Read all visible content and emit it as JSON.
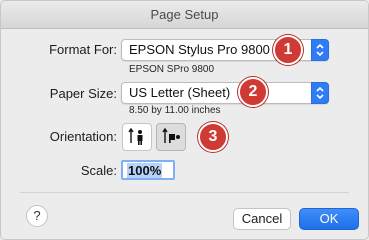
{
  "window": {
    "title": "Page Setup"
  },
  "format_for": {
    "label": "Format For:",
    "value": "EPSON Stylus Pro 9800",
    "subtitle": "EPSON SPro 9800",
    "badge": "1"
  },
  "paper_size": {
    "label": "Paper Size:",
    "value": "US Letter (Sheet)",
    "subtitle": "8.50 by 11.00 inches",
    "badge": "2"
  },
  "orientation": {
    "label": "Orientation:",
    "options": [
      "portrait",
      "landscape"
    ],
    "selected": "landscape",
    "badge": "3"
  },
  "scale": {
    "label": "Scale:",
    "value": "100%"
  },
  "buttons": {
    "help": "?",
    "cancel": "Cancel",
    "ok": "OK"
  },
  "colors": {
    "accent": "#2f7df6",
    "badge": "#cf3a34"
  }
}
